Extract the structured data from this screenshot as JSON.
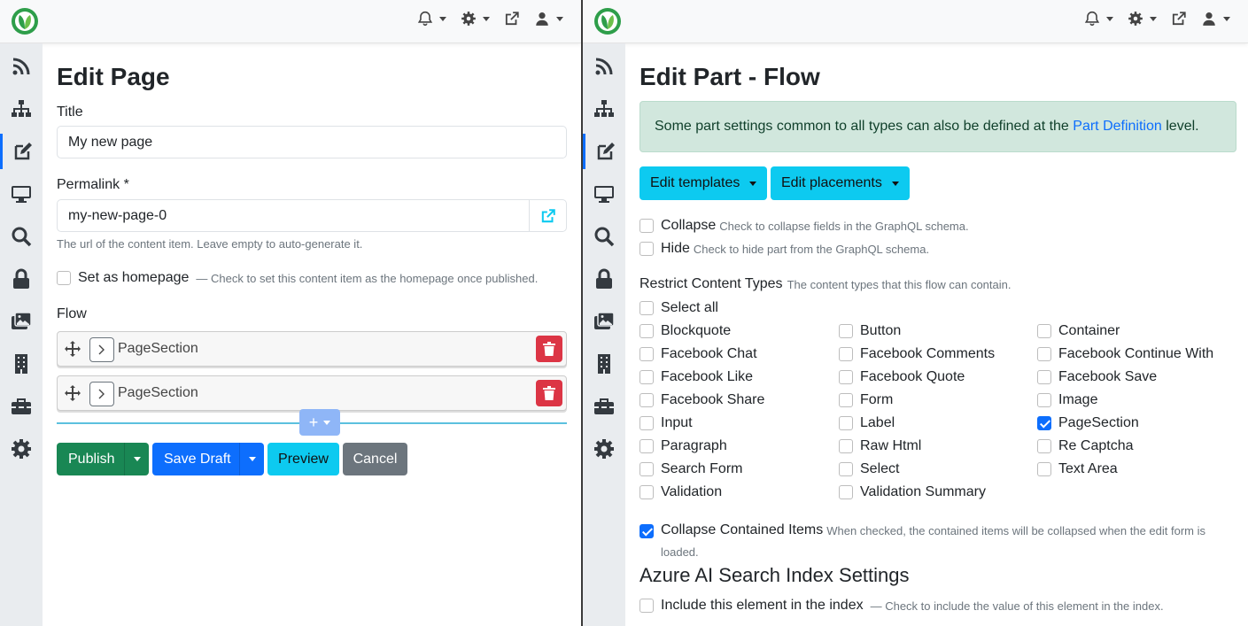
{
  "colors": {
    "primary": "#0d6efd",
    "success": "#198754",
    "info": "#0dcaf0",
    "danger": "#dc3545",
    "secondary": "#6c757d",
    "sidebar_bg": "#e9ecef",
    "alert_bg": "#d1e7dd"
  },
  "sidebar_icons": [
    "rss-icon",
    "sitemap-icon",
    "edit-icon",
    "desktop-icon",
    "search-icon",
    "lock-icon",
    "images-icon",
    "building-icon",
    "toolbox-icon",
    "gear-icon"
  ],
  "left": {
    "title": "Edit Page",
    "title_field": {
      "label": "Title",
      "value": "My new page"
    },
    "permalink": {
      "label": "Permalink *",
      "value": "my-new-page-0",
      "hint": "The url of the content item. Leave empty to auto-generate it."
    },
    "homepage": {
      "label": "Set as homepage",
      "hint": "— Check to set this content item as the homepage once published."
    },
    "flow": {
      "label": "Flow",
      "items": [
        "PageSection",
        "PageSection"
      ],
      "add_symbol": "+"
    },
    "buttons": {
      "publish": "Publish",
      "save_draft": "Save Draft",
      "preview": "Preview",
      "cancel": "Cancel"
    }
  },
  "right": {
    "title": "Edit Part - Flow",
    "alert": {
      "text_before": "Some part settings common to all types can also be defined at the",
      "link": "Part Definition",
      "text_after": "level."
    },
    "dropdowns": {
      "templates": "Edit templates",
      "placements": "Edit placements"
    },
    "collapse": {
      "label": "Collapse",
      "hint": "Check to collapse fields in the GraphQL schema."
    },
    "hide": {
      "label": "Hide",
      "hint": "Check to hide part from the GraphQL schema."
    },
    "restrict": {
      "label": "Restrict Content Types",
      "hint": "The content types that this flow can contain.",
      "select_all": "Select all"
    },
    "types": [
      {
        "name": "Blockquote",
        "checked": false
      },
      {
        "name": "Button",
        "checked": false
      },
      {
        "name": "Container",
        "checked": false
      },
      {
        "name": "Facebook Chat",
        "checked": false
      },
      {
        "name": "Facebook Comments",
        "checked": false
      },
      {
        "name": "Facebook Continue With",
        "checked": false
      },
      {
        "name": "Facebook Like",
        "checked": false
      },
      {
        "name": "Facebook Quote",
        "checked": false
      },
      {
        "name": "Facebook Save",
        "checked": false
      },
      {
        "name": "Facebook Share",
        "checked": false
      },
      {
        "name": "Form",
        "checked": false
      },
      {
        "name": "Image",
        "checked": false
      },
      {
        "name": "Input",
        "checked": false
      },
      {
        "name": "Label",
        "checked": false
      },
      {
        "name": "PageSection",
        "checked": true
      },
      {
        "name": "Paragraph",
        "checked": false
      },
      {
        "name": "Raw Html",
        "checked": false
      },
      {
        "name": "Re Captcha",
        "checked": false
      },
      {
        "name": "Search Form",
        "checked": false
      },
      {
        "name": "Select",
        "checked": false
      },
      {
        "name": "Text Area",
        "checked": false
      },
      {
        "name": "Validation",
        "checked": false
      },
      {
        "name": "Validation Summary",
        "checked": false
      }
    ],
    "collapse_contained": {
      "label": "Collapse Contained Items",
      "hint_line1": "When checked, the contained items will be collapsed when the edit form is",
      "hint_line2": "loaded."
    },
    "azure": {
      "heading": "Azure AI Search Index Settings",
      "label": "Include this element in the index",
      "hint": "— Check to include the value of this element in the index."
    }
  }
}
